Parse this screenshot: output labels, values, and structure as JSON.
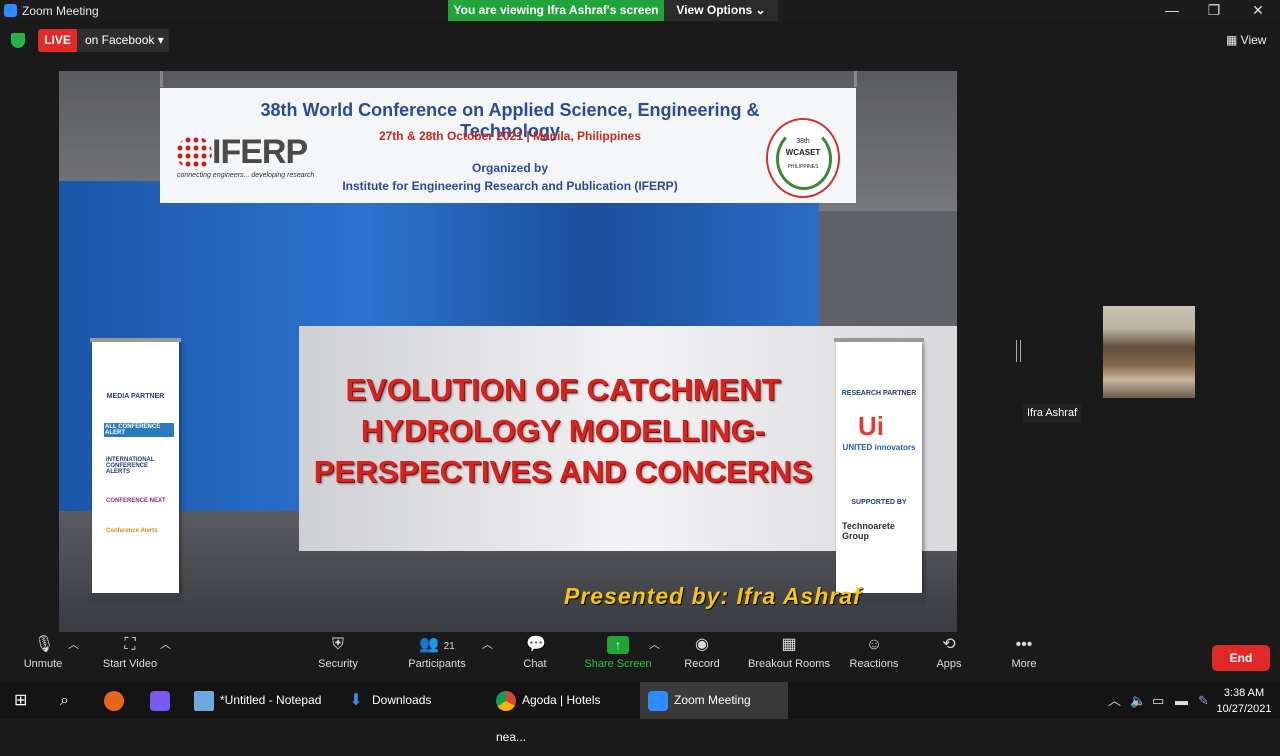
{
  "window": {
    "title": "Zoom Meeting",
    "viewing_banner": "You are viewing Ifra Ashraf's screen",
    "view_options": "View Options ⌄",
    "minimize": "—",
    "restore": "❐",
    "close": "✕"
  },
  "live": {
    "badge": "LIVE",
    "destination": "on Facebook ▾"
  },
  "view_button": "▦ View",
  "shared_screen": {
    "banner": {
      "logo_text": "IFERP",
      "tagline": "connecting engineers... developing research",
      "title": "38th World Conference on Applied Science, Engineering & Technology",
      "date_place": "27th & 28th October 2021 | Manila, Philippines",
      "organized_by": "Organized by",
      "institute": "Institute for Engineering Research and Publication (IFERP)",
      "seal_number": "38th",
      "seal_name": "WCASET",
      "seal_country": "PHILIPPINES"
    },
    "slide_title_line1": "EVOLUTION OF CATCHMENT",
    "slide_title_line2": "HYDROLOGY MODELLING-",
    "slide_title_line3": "PERSPECTIVES AND CONCERNS",
    "presenter": "Presented by: Ifra Ashraf",
    "left_standee": {
      "heading": "MEDIA PARTNER",
      "logos": [
        "ALL CONFERENCE ALERT",
        "INTERNATIONAL CONFERENCE ALERTS",
        "CONFERENCE NEXT",
        "Conference Alerts"
      ]
    },
    "right_standee": {
      "heading": "RESEARCH PARTNER",
      "ui_logo": "Ui",
      "ui_name": "UNITED innovators",
      "supported_by": "SUPPORTED BY",
      "techno": "Technoarete Group"
    }
  },
  "participant": {
    "name": "Ifra Ashraf"
  },
  "toolbar": {
    "unmute": "Unmute",
    "start_video": "Start Video",
    "security": "Security",
    "participants": "Participants",
    "participants_count": "21",
    "chat": "Chat",
    "share_screen": "Share Screen",
    "record": "Record",
    "breakout_rooms": "Breakout Rooms",
    "reactions": "Reactions",
    "apps": "Apps",
    "more": "More",
    "end": "End"
  },
  "taskbar": {
    "notepad": "*Untitled - Notepad",
    "downloads": "Downloads",
    "agoda": "Agoda | Hotels nea...",
    "zoom": "Zoom Meeting",
    "time": "3:38 AM",
    "date": "10/27/2021"
  }
}
